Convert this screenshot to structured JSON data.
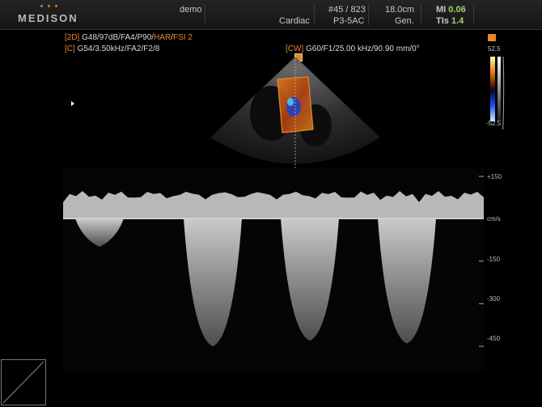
{
  "header": {
    "brand": "MEDISON",
    "user": "demo",
    "app": "Cardiac",
    "frame": "#45 / 823",
    "probe": "P3-5AC",
    "depth": "18.0cm",
    "preset": "Gen.",
    "mi_label": "MI",
    "mi_value": "0.06",
    "tis_label": "TIs",
    "tis_value": "1.4"
  },
  "params": {
    "line1_tag": "[2D]",
    "line1_text": "G48/97dB/FA4/P90/",
    "line1_har": "HAR",
    "line1_sep": "/",
    "line1_fsi": "FSI 2",
    "line2_tag": "[C]",
    "line2_text": "G54/3.50kHz/FA2/F2/8",
    "cw_tag": "[CW]",
    "cw_text": "G60/F1/25.00 kHz/90.90 mm/0°"
  },
  "colorbar": {
    "top_value": "52.5",
    "bottom_value": "-52.5"
  },
  "doppler": {
    "unit": "cm/s",
    "ticks": [
      "+150",
      "-150",
      "-300",
      "-450"
    ]
  },
  "chart_data": {
    "type": "line",
    "title": "",
    "xlabel": "",
    "ylabel": "cm/s",
    "ylim": [
      -450,
      150
    ],
    "tick_labels": [
      "+150",
      "-150",
      "-300",
      "-450"
    ],
    "series": [
      {
        "values": [
          {
            "x": 0,
            "y": 0
          },
          {
            "x": 1,
            "y": -100
          },
          {
            "x": 2,
            "y": 0
          },
          {
            "x": 3,
            "y": -450
          },
          {
            "x": 4,
            "y": 0
          },
          {
            "x": 5,
            "y": -430
          },
          {
            "x": 6,
            "y": 0
          },
          {
            "x": 7,
            "y": -440
          },
          {
            "x": 8,
            "y": 0
          }
        ]
      }
    ]
  },
  "colors": {
    "accent": "#e38a2a",
    "mi": "#a7d36b",
    "background": "#000000"
  }
}
